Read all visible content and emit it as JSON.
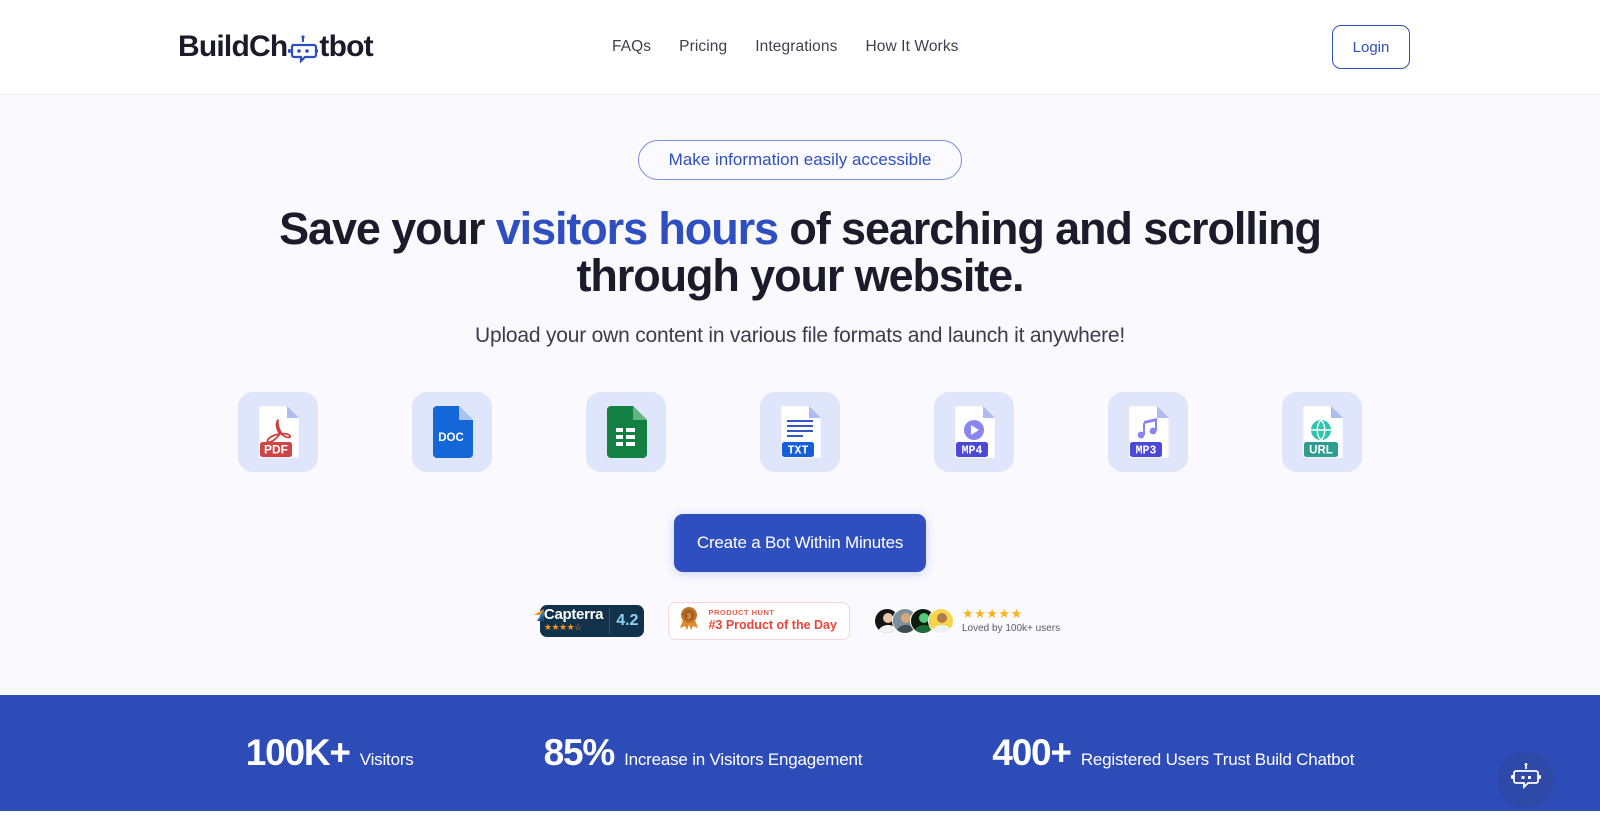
{
  "header": {
    "logo": {
      "text_before": "BuildCh",
      "text_after": "tbot",
      "icon": "robot-icon"
    },
    "nav": [
      {
        "label": "FAQs"
      },
      {
        "label": "Pricing"
      },
      {
        "label": "Integrations"
      },
      {
        "label": "How It Works"
      }
    ],
    "login_label": "Login"
  },
  "hero": {
    "pill_label": "Make information easily accessible",
    "headline_part1": "Save your ",
    "headline_highlight": "visitors hours",
    "headline_part2": " of searching and scrolling through your website.",
    "subtitle": "Upload your own content in various file formats and launch it anywhere!",
    "cta_label": "Create a Bot Within Minutes",
    "file_types": [
      {
        "label": "PDF",
        "icon": "pdf-file-icon",
        "color": "#d64545"
      },
      {
        "label": "DOC",
        "icon": "doc-file-icon",
        "color": "#1566d6"
      },
      {
        "label": "SHEET",
        "icon": "sheet-file-icon",
        "color": "#1a8043"
      },
      {
        "label": "TXT",
        "icon": "txt-file-icon",
        "color": "#1560d8"
      },
      {
        "label": "MP4",
        "icon": "mp4-file-icon",
        "color": "#4b49d6"
      },
      {
        "label": "MP3",
        "icon": "mp3-file-icon",
        "color": "#4b49d6"
      },
      {
        "label": "URL",
        "icon": "url-file-icon",
        "color": "#2e9c8e"
      }
    ]
  },
  "badges": {
    "capterra": {
      "name": "Capterra",
      "score": "4.2",
      "stars": "★★★★☆"
    },
    "product_hunt": {
      "top_label": "PRODUCT HUNT",
      "main_label": "#3 Product of the Day"
    },
    "loved": {
      "stars": "★★★★★",
      "text": "Loved by 100k+ users",
      "avatar_count": 4
    }
  },
  "stats": [
    {
      "number": "100K+",
      "label": "Visitors"
    },
    {
      "number": "85%",
      "label": "Increase in Visitors Engagement"
    },
    {
      "number": "400+",
      "label": "Registered Users Trust Build Chatbot"
    }
  ],
  "chat_widget": {
    "icon": "robot-chat-icon"
  },
  "colors": {
    "brand_blue": "#2f4fc0",
    "stats_band": "#2e4cb8",
    "hero_bg": "#f9f9fe",
    "headline_dark": "#1b1b29"
  }
}
